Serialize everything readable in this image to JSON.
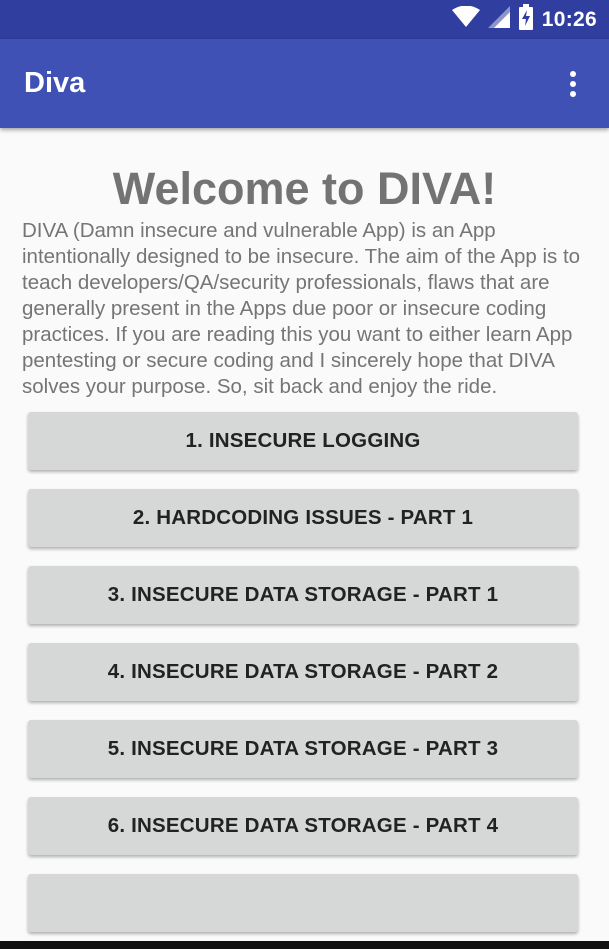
{
  "status_bar": {
    "time": "10:26",
    "icons": [
      "wifi-icon",
      "cell-signal-icon",
      "battery-charging-icon"
    ]
  },
  "app_bar": {
    "title": "Diva",
    "menu_icon": "overflow-menu-icon"
  },
  "main": {
    "welcome": "Welcome to DIVA!",
    "intro": "DIVA (Damn insecure and vulnerable App) is an App intentionally designed to be insecure. The aim of the App is to teach developers/QA/security professionals, flaws that are generally present in the Apps due poor or insecure coding practices. If you are reading this you want to either learn App pentesting or secure coding and I sincerely hope that DIVA solves your purpose. So, sit back and enjoy the ride.",
    "buttons": [
      "1. INSECURE LOGGING",
      "2. HARDCODING ISSUES - PART 1",
      "3. INSECURE DATA STORAGE - PART 1",
      "4. INSECURE DATA STORAGE - PART 2",
      "5. INSECURE DATA STORAGE - PART 3",
      "6. INSECURE DATA STORAGE - PART 4",
      ""
    ]
  },
  "colors": {
    "status_bar": "#303f9f",
    "app_bar": "#3f51b5",
    "button": "#d6d7d7",
    "text_gray": "#757575"
  }
}
